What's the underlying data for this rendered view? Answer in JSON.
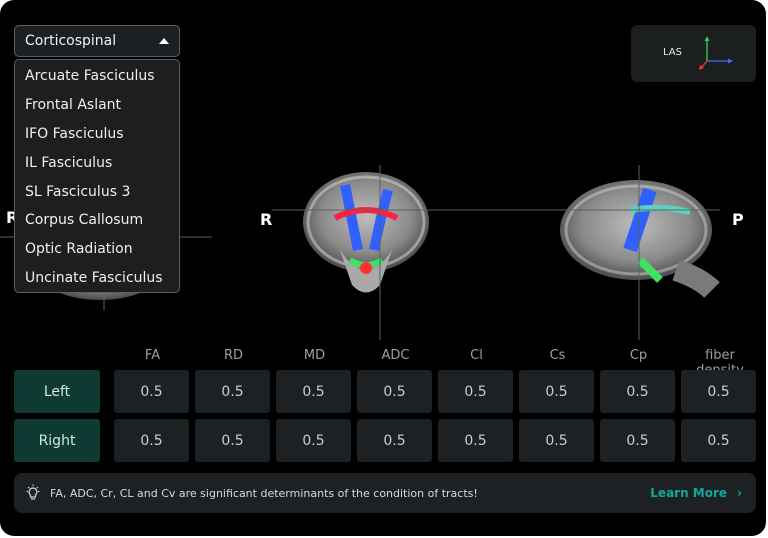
{
  "tract_select": {
    "selected": "Corticospinal",
    "options": [
      "Arcuate Fasciculus",
      "Frontal Aslant",
      "IFO Fasciculus",
      "IL Fasciculus",
      "SL Fasciculus 3",
      "Corpus Callosum",
      "Optic Radiation",
      "Uncinate Fasciculus"
    ]
  },
  "orientation": {
    "label": "LAS",
    "icon": "axes-icon"
  },
  "viewer": {
    "labels": {
      "axial_right": "R",
      "coronal_right": "R",
      "sagittal_posterior": "P"
    }
  },
  "metrics": {
    "columns": [
      "FA",
      "RD",
      "MD",
      "ADC",
      "Cl",
      "Cs",
      "Cp",
      "fiber density"
    ],
    "rows": [
      {
        "label": "Left",
        "values": [
          "0.5",
          "0.5",
          "0.5",
          "0.5",
          "0.5",
          "0.5",
          "0.5",
          "0.5"
        ]
      },
      {
        "label": "Right",
        "values": [
          "0.5",
          "0.5",
          "0.5",
          "0.5",
          "0.5",
          "0.5",
          "0.5",
          "0.5"
        ]
      }
    ]
  },
  "info_bar": {
    "message": "FA, ADC, Cr, CL and Cv are significant determinants of the condition of tracts!",
    "link": "Learn More",
    "icon": "lightbulb-icon"
  },
  "colors": {
    "accent": "#13a89a",
    "row_label_bg": "#0e3a33",
    "cell_bg": "#1d2123"
  }
}
